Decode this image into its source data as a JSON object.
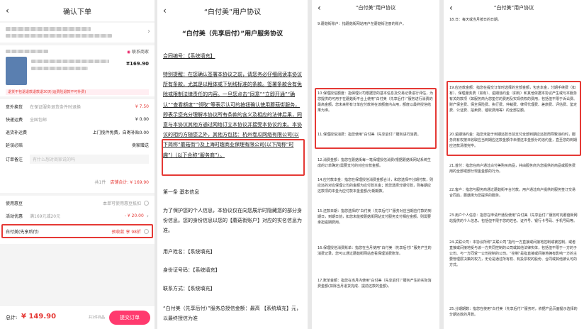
{
  "p1": {
    "title": "确认下单",
    "contact": "联系商家",
    "price": "¥169.90",
    "return_note": "退货不包退退款退款退30天(运费险退款不可补费)",
    "rows": [
      {
        "label": "意外换货",
        "value": "在保证服务退货条件时退换",
        "amount": "¥ 7.50"
      },
      {
        "label": "快递运费",
        "value": "全国包邮",
        "amount": "¥ 0.00"
      },
      {
        "label": "退货补运费",
        "value": "",
        "amount": "上门揽件免费，自寄补贴0.00"
      },
      {
        "label": "延误必赔",
        "value": "",
        "amount": "卖家赠送"
      },
      {
        "label": "订单备注",
        "value": "",
        "amount": "有什么想对商家说的吗"
      }
    ],
    "subtotal_label": "共1件",
    "subtotal": "店铺合计: ¥ 169.90",
    "coupon_label": "使用惠豆",
    "coupon_value": "本单可使用惠豆抵扣",
    "promo_label": "活动优惠",
    "promo_detail": "满169元减20元",
    "promo_value": "- ¥ 20.00",
    "pay_label": "白付美(先享后付)",
    "pay_value": "预收款 享 98折",
    "total_label": "总计:",
    "total": "¥ 149.90",
    "count": "共1件商品",
    "submit": "提交订单"
  },
  "p2": {
    "title": "“白付美”用户协议",
    "heading": "“白付美（先享后付）”用户服务协议",
    "contract": "合同编号：【系统填充】",
    "para1": "特别提醒：在您确认签署本协议之前，请您务必仔细阅读本协议所有条款，尤其是以粗体或下划线标准的条款。签署条款含有免除或限制法律责任的内容。一旦您点击“同意”“立即开通”“确认”“查看额度”“领取”等表示认可的按钮确认使用蘑菇街服务，即表示您充分理解本协议所有条款的含义及相应的法律后果，同意与本协议其他方通过网络订立本协议并接受本协议约束。本协议的相约方随您之外，其他方包括：杭州卷瓜网络有限公司(以下简称“蘑菇街”)及上海时趣商业保理有限公司(以下简称“时趣”)（以下合称“服务商”）。",
    "section": "第一条 基本信息",
    "para2": "为了保护您的个人信息，本协议仅在向您展示时隐藏您的部分身份信息。您的身份信息以您的【蘑菇街账户】对应的实名信息为准。",
    "user": "用户姓名：【系统填充】",
    "id": "身份证号码：【系统填充】",
    "contact": "联系方式：【系统填充】",
    "para3": "“白付美（先享后付）”服务总授信金额：最高 【系统填充】元，以最终授信为准"
  },
  "p3": {
    "title": "“白付美”用户协议",
    "l1": "9.蘑菇街账户：指蘑菇街网站用户在蘑菇街注册的账户。",
    "b1": "10.保理授信额度：指保理公司根据您的基本信息及交易记录进行评估，为您提供的可用于在蘑菇街平台上使用“白付美（先享后付）”服务进行消费的最高金额，您未来所有订单应付款将在该额度内占用，额度以最终授信结果为准。",
    "b2": "11.保理授信消费：指您使用“白付美（先享后付）”服务进行消费。",
    "l2": "12.消费金额：指您在蘑菇街每一笔保理授信消费(根据蘑菇街网站系统生成的订单确定)需要支付的对应价款金额。",
    "l3": "14.应付款本金：指您在保理授信消费金额合计，和您选择不分期付款，则应还的对应保理公司的金额为应付款本金；若您选择分期付款，则每期应还款项的本金为应付款本金金额/分期期数。",
    "l4": "15.还款日期：指您选择的“白付美（先享后付）”服务对应当期应付款的到期日，到期日前，如您未能按蘑菇街网站支付服务支付相应金额，则需要承担逾期费用。",
    "l5": "16.保理授信消费账单：指您在当月使用“白付美（先享后付）”服务产生的消费记录，您可以通过蘑菇街网站查看保理消费账单。",
    "l6": "17.账单金额：指您在当月内使用“白付美（先享后付）”服务产生的实际消费金额(扣除当月退货完成、提前还款的金额)。"
  },
  "p4": {
    "title": "“白付美”用户协议",
    "l0": "18.日：每天或当月按日的日期。",
    "b1": "19.应还款金额：指您在提交订单时选择的全部金额，包含本金，分期手续费（如有）、保理服务费（如有）、逾期违约金（如有）和其他依据本协议产生或与本服务有关的款项（如服务商为您垫付的费用及实现债权的费用，包括但不限于诉讼费、财产保全费、保全保险费、执行费、仲裁费、律师代理费、差旅费、评估费、鉴定费、公证费、拍卖费、催收费用等）的全部总额。",
    "b2": "20.逾期违约金：指您未能于到期还款日前支付全部到期应还款而导致违约时，服务商有权按日收取应当到期应还款金额中未偿还本金部分的违约金，直至您的到期应还款清偿完毕。",
    "l1": "21.首付：指您在商户通过白付美购买商品，并由服务商为您提供的商品或服务费用的全部或部分现金金额的行为。",
    "l2": "22.客户：指您与服务商通过蘑菇街平台付款，用户通过商户提供的服务签订交易合同后，蘑菇街为您提供的服务。",
    "l3": "23.用户个人信息：指您在申请开通及使用“白付美（先享后付）”服务时向蘑菇街网站提供的个人信息，包括但不限于您的姓名、证件号、银行卡号码、手机号码等。",
    "l4": "24.关联公司：本协议所称“关联公司”指与一方直接或间接地控制或被控制，或者直接或间接地受与该一方共同控制的公司或其他法律实体，包括但不限于一方的子公司、与一方同受一公司控制的公司。“控制”是指直接或间接地拥有影响一方的主要管理层决策的权力，无论是通过所有权、有投票权的股份、合同或其他被认可的方式。",
    "l5": "25.分期期数：指您在使用“白付美（先享后付）”服务时，依据产品页面提示选择的分期还款的月数。"
  }
}
